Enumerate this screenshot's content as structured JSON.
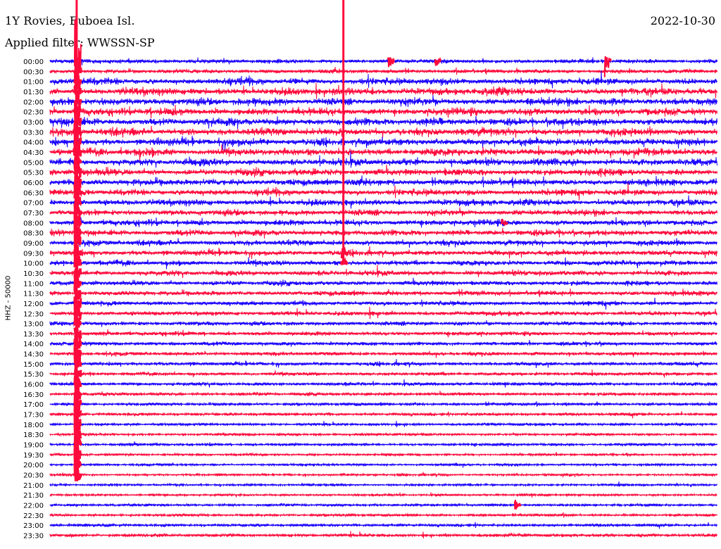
{
  "header": {
    "title": "1Y Rovies, Euboea Isl.",
    "date": "2022-10-30",
    "filter": "Applied filter: WWSSN-SP"
  },
  "chart_data": {
    "type": "line",
    "chart_kind": "helicorder",
    "channel_label": "HHZ - 50000",
    "trace_interval_minutes": 30,
    "x_ticks": [],
    "grid": false,
    "series_colors": [
      "#1a00ff",
      "#ff0a3c"
    ],
    "rows": [
      {
        "time": "00:00",
        "color": "#1a00ff",
        "amplitude": 0.55
      },
      {
        "time": "00:30",
        "color": "#ff0a3c",
        "amplitude": 0.55
      },
      {
        "time": "01:00",
        "color": "#1a00ff",
        "amplitude": 0.9
      },
      {
        "time": "01:30",
        "color": "#ff0a3c",
        "amplitude": 1.0
      },
      {
        "time": "02:00",
        "color": "#1a00ff",
        "amplitude": 1.0
      },
      {
        "time": "02:30",
        "color": "#ff0a3c",
        "amplitude": 1.0
      },
      {
        "time": "03:00",
        "color": "#1a00ff",
        "amplitude": 1.0
      },
      {
        "time": "03:30",
        "color": "#ff0a3c",
        "amplitude": 1.0
      },
      {
        "time": "04:00",
        "color": "#1a00ff",
        "amplitude": 1.0
      },
      {
        "time": "04:30",
        "color": "#ff0a3c",
        "amplitude": 1.0
      },
      {
        "time": "05:00",
        "color": "#1a00ff",
        "amplitude": 0.95
      },
      {
        "time": "05:30",
        "color": "#ff0a3c",
        "amplitude": 0.95
      },
      {
        "time": "06:00",
        "color": "#1a00ff",
        "amplitude": 0.9
      },
      {
        "time": "06:30",
        "color": "#ff0a3c",
        "amplitude": 0.85
      },
      {
        "time": "07:00",
        "color": "#1a00ff",
        "amplitude": 0.85
      },
      {
        "time": "07:30",
        "color": "#ff0a3c",
        "amplitude": 0.8
      },
      {
        "time": "08:00",
        "color": "#1a00ff",
        "amplitude": 0.8
      },
      {
        "time": "08:30",
        "color": "#ff0a3c",
        "amplitude": 0.8
      },
      {
        "time": "09:00",
        "color": "#1a00ff",
        "amplitude": 0.75
      },
      {
        "time": "09:30",
        "color": "#ff0a3c",
        "amplitude": 0.75
      },
      {
        "time": "10:00",
        "color": "#1a00ff",
        "amplitude": 0.7
      },
      {
        "time": "10:30",
        "color": "#ff0a3c",
        "amplitude": 0.7
      },
      {
        "time": "11:00",
        "color": "#1a00ff",
        "amplitude": 0.65
      },
      {
        "time": "11:30",
        "color": "#ff0a3c",
        "amplitude": 0.65
      },
      {
        "time": "12:00",
        "color": "#1a00ff",
        "amplitude": 0.6
      },
      {
        "time": "12:30",
        "color": "#ff0a3c",
        "amplitude": 0.6
      },
      {
        "time": "13:00",
        "color": "#1a00ff",
        "amplitude": 0.55
      },
      {
        "time": "13:30",
        "color": "#ff0a3c",
        "amplitude": 0.55
      },
      {
        "time": "14:00",
        "color": "#1a00ff",
        "amplitude": 0.5
      },
      {
        "time": "14:30",
        "color": "#ff0a3c",
        "amplitude": 0.5
      },
      {
        "time": "15:00",
        "color": "#1a00ff",
        "amplitude": 0.5
      },
      {
        "time": "15:30",
        "color": "#ff0a3c",
        "amplitude": 0.45
      },
      {
        "time": "16:00",
        "color": "#1a00ff",
        "amplitude": 0.45
      },
      {
        "time": "16:30",
        "color": "#ff0a3c",
        "amplitude": 0.45
      },
      {
        "time": "17:00",
        "color": "#1a00ff",
        "amplitude": 0.4
      },
      {
        "time": "17:30",
        "color": "#ff0a3c",
        "amplitude": 0.4
      },
      {
        "time": "18:00",
        "color": "#1a00ff",
        "amplitude": 0.35
      },
      {
        "time": "18:30",
        "color": "#ff0a3c",
        "amplitude": 0.35
      },
      {
        "time": "19:00",
        "color": "#1a00ff",
        "amplitude": 0.35
      },
      {
        "time": "19:30",
        "color": "#ff0a3c",
        "amplitude": 0.3
      },
      {
        "time": "20:00",
        "color": "#1a00ff",
        "amplitude": 0.3
      },
      {
        "time": "20:30",
        "color": "#ff0a3c",
        "amplitude": 0.3
      },
      {
        "time": "21:00",
        "color": "#1a00ff",
        "amplitude": 0.3
      },
      {
        "time": "21:30",
        "color": "#ff0a3c",
        "amplitude": 0.3
      },
      {
        "time": "22:00",
        "color": "#1a00ff",
        "amplitude": 0.35
      },
      {
        "time": "22:30",
        "color": "#ff0a3c",
        "amplitude": 0.35
      },
      {
        "time": "23:00",
        "color": "#1a00ff",
        "amplitude": 0.4
      },
      {
        "time": "23:30",
        "color": "#ff0a3c",
        "amplitude": 0.45
      }
    ],
    "events": [
      {
        "time": "00:00",
        "color": "#ff0a3c",
        "x_fraction": 0.04,
        "amplitude": 10,
        "trace_rows": 42
      },
      {
        "time": "00:00",
        "color": "#ff0a3c",
        "x_fraction": 0.835,
        "amplitude": 3.0,
        "trace_rows": 1
      },
      {
        "time": "00:00",
        "color": "#ff0a3c",
        "x_fraction": 0.51,
        "amplitude": 2.0,
        "trace_rows": 1
      },
      {
        "time": "00:00",
        "color": "#ff0a3c",
        "x_fraction": 0.58,
        "amplitude": 1.6,
        "trace_rows": 1
      },
      {
        "time": "09:30",
        "color": "#ff0a3c",
        "x_fraction": 0.44,
        "amplitude": 1.6,
        "trace_rows": 2
      },
      {
        "time": "08:00",
        "color": "#ff0a3c",
        "x_fraction": 0.68,
        "amplitude": 1.4,
        "trace_rows": 1
      },
      {
        "time": "22:00",
        "color": "#ff0a3c",
        "x_fraction": 0.7,
        "amplitude": 1.5,
        "trace_rows": 1
      }
    ]
  }
}
